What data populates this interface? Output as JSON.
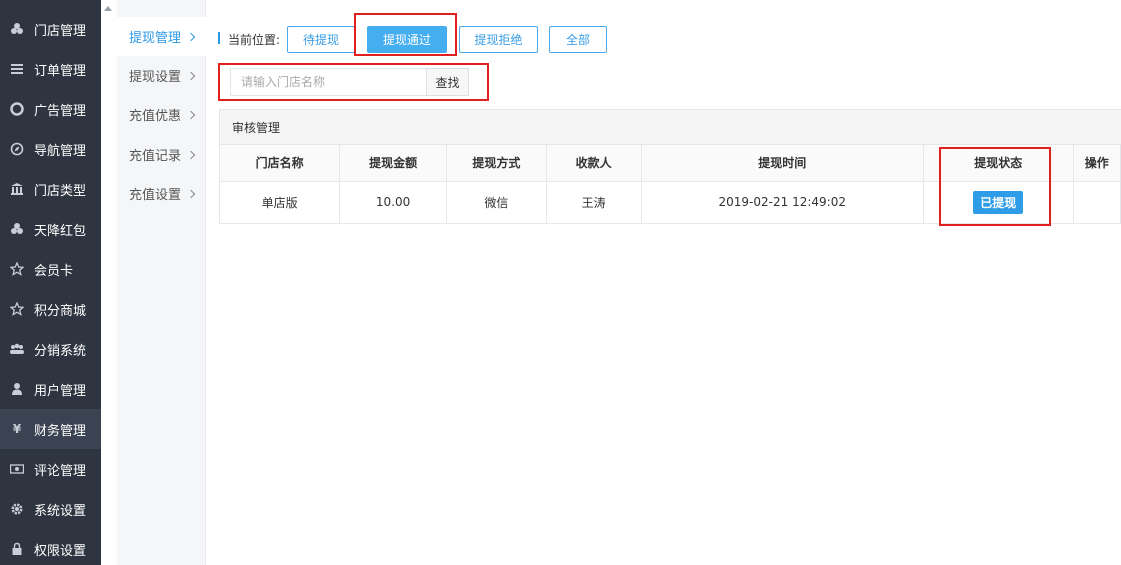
{
  "sidebar": {
    "items": [
      {
        "label": "门店管理",
        "icon": "shop-icon"
      },
      {
        "label": "订单管理",
        "icon": "list-icon"
      },
      {
        "label": "广告管理",
        "icon": "lifebuoy-icon"
      },
      {
        "label": "导航管理",
        "icon": "compass-icon"
      },
      {
        "label": "门店类型",
        "icon": "bank-icon"
      },
      {
        "label": "天降红包",
        "icon": "shop-icon"
      },
      {
        "label": "会员卡",
        "icon": "star-icon"
      },
      {
        "label": "积分商城",
        "icon": "star-icon"
      },
      {
        "label": "分销系统",
        "icon": "users-icon"
      },
      {
        "label": "用户管理",
        "icon": "user-icon"
      },
      {
        "label": "财务管理",
        "icon": "yen-icon"
      },
      {
        "label": "评论管理",
        "icon": "money-icon"
      },
      {
        "label": "系统设置",
        "icon": "gear-icon"
      },
      {
        "label": "权限设置",
        "icon": "lock-icon"
      }
    ],
    "active_index": 10
  },
  "submenu": {
    "items": [
      {
        "label": "提现管理"
      },
      {
        "label": "提现设置"
      },
      {
        "label": "充值优惠"
      },
      {
        "label": "充值记录"
      },
      {
        "label": "充值设置"
      }
    ]
  },
  "breadcrumb": {
    "label": "当前位置:"
  },
  "tabs": [
    {
      "label": "待提现"
    },
    {
      "label": "提现通过"
    },
    {
      "label": "提现拒绝"
    },
    {
      "label": "全部"
    }
  ],
  "search": {
    "placeholder": "请输入门店名称",
    "value": "",
    "button": "查找"
  },
  "panel": {
    "title": "审核管理"
  },
  "table": {
    "headers": [
      "门店名称",
      "提现金额",
      "提现方式",
      "收款人",
      "提现时间",
      "提现状态",
      "操作"
    ],
    "rows": [
      {
        "store": "单店版",
        "amount": "10.00",
        "method": "微信",
        "payee": "王涛",
        "time": "2019-02-21 12:49:02",
        "status": "已提现",
        "action": ""
      }
    ]
  },
  "colors": {
    "accent": "#2b98e6",
    "sidebar_bg": "#2f3441",
    "highlight_box": "#e0201c"
  }
}
